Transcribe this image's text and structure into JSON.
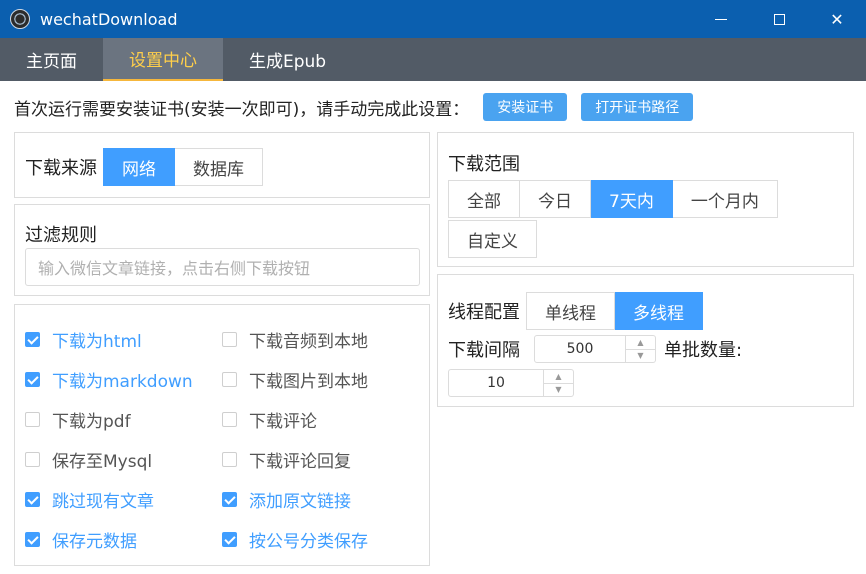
{
  "window": {
    "title": "wechatDownload",
    "minimize_label": "",
    "close_label": "✕"
  },
  "tabs": [
    {
      "label": "主页面",
      "active": false
    },
    {
      "label": "设置中心",
      "active": true
    },
    {
      "label": "生成Epub",
      "active": false
    }
  ],
  "cert": {
    "text": "首次运行需要安装证书(安装一次即可)，请手动完成此设置：",
    "install_label": "安装证书",
    "open_path_label": "打开证书路径"
  },
  "source": {
    "label": "下载来源",
    "options": [
      "网络",
      "数据库"
    ],
    "selected": "网络"
  },
  "filter": {
    "label": "过滤规则",
    "placeholder": "输入微信文章链接，点击右侧下载按钮"
  },
  "options": [
    {
      "label": "下载为html",
      "checked": true
    },
    {
      "label": "下载音频到本地",
      "checked": false
    },
    {
      "label": "下载为markdown",
      "checked": true
    },
    {
      "label": "下载图片到本地",
      "checked": false
    },
    {
      "label": "下载为pdf",
      "checked": false
    },
    {
      "label": "下载评论",
      "checked": false
    },
    {
      "label": "保存至Mysql",
      "checked": false
    },
    {
      "label": "下载评论回复",
      "checked": false
    },
    {
      "label": "跳过现有文章",
      "checked": true
    },
    {
      "label": "添加原文链接",
      "checked": true
    },
    {
      "label": "保存元数据",
      "checked": true
    },
    {
      "label": "按公号分类保存",
      "checked": true
    }
  ],
  "range": {
    "label": "下载范围",
    "options": [
      "全部",
      "今日",
      "7天内",
      "一个月内",
      "自定义"
    ],
    "selected": "7天内"
  },
  "thread": {
    "label": "线程配置",
    "options": [
      "单线程",
      "多线程"
    ],
    "selected": "多线程",
    "interval_label": "下载间隔",
    "interval_value": "500",
    "batch_label": "单批数量:",
    "batch_value": "10"
  },
  "colors": {
    "titlebar": "#0b5faf",
    "tabbar": "#525b66",
    "accent": "#409eff",
    "active_tab_text": "#ffcf4a"
  }
}
